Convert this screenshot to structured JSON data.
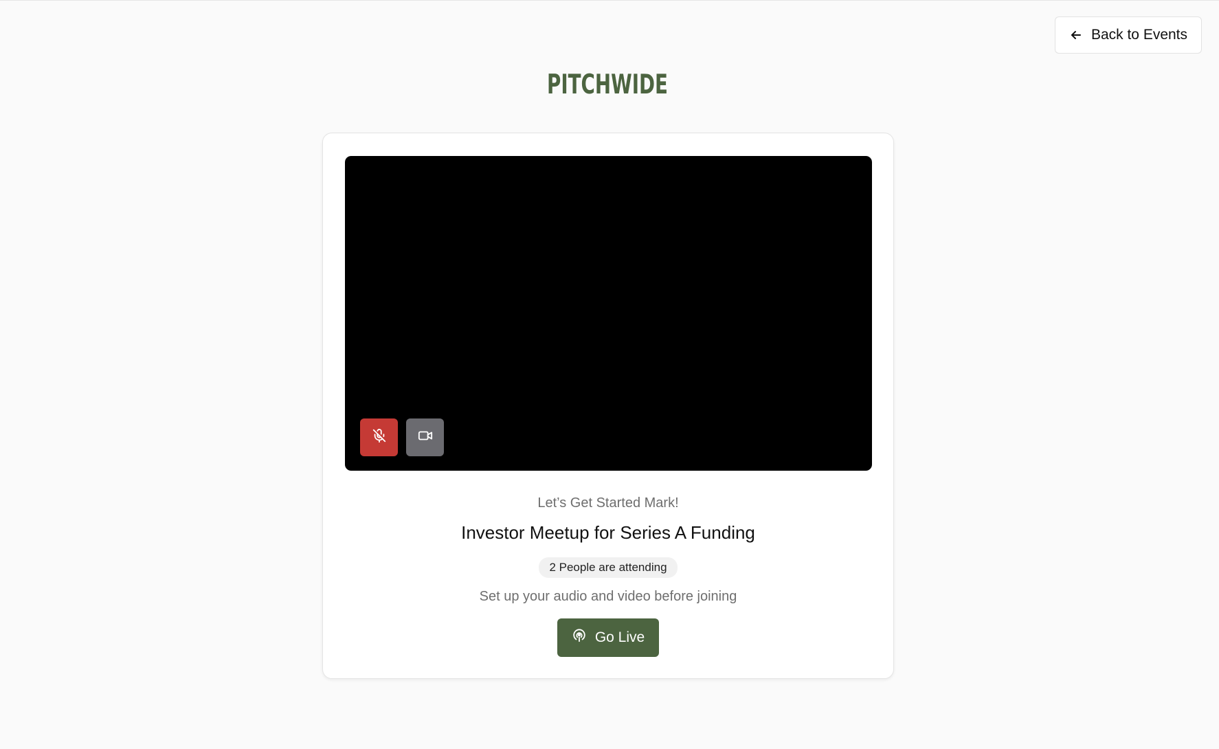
{
  "header": {
    "back_label": "Back to Events"
  },
  "brand": {
    "logo_text": "PITCHWIDE",
    "color": "#4c6440"
  },
  "preview": {
    "mic_state": "muted",
    "camera_state": "off"
  },
  "event": {
    "greeting": "Let’s Get Started Mark!",
    "title": "Investor Meetup for Series A Funding",
    "attending": "2 People are attending",
    "setup_hint": "Set up your audio and video before joining",
    "cta_label": "Go Live"
  },
  "colors": {
    "accent": "#4c6440",
    "mic_muted": "#c53a35",
    "camera_btn": "#6b6b70",
    "background": "#fafafa"
  }
}
